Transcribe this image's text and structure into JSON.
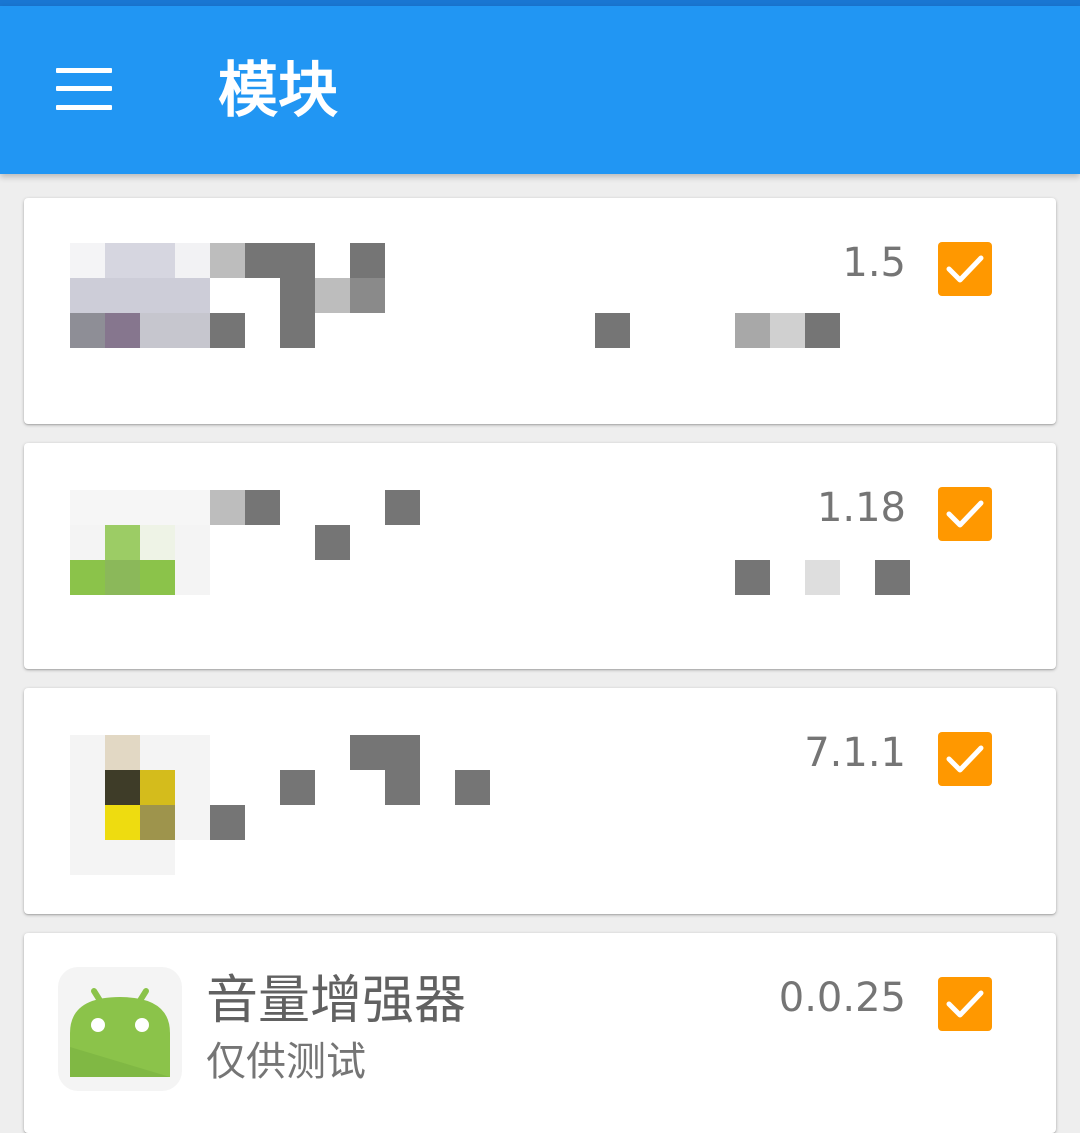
{
  "appbar": {
    "title": "模块",
    "menu_icon": "menu-icon"
  },
  "colors": {
    "appbar": "#2196F3",
    "status": "#1976D2",
    "accent": "#FF9800",
    "background": "#EEEEEE"
  },
  "modules": [
    {
      "name": "",
      "description": "",
      "version": "1.5",
      "enabled": true
    },
    {
      "name": "",
      "description": "",
      "version": "1.18",
      "enabled": true
    },
    {
      "name": "",
      "description": "",
      "version": "7.1.1",
      "enabled": true
    },
    {
      "name": "音量增强器",
      "description": "仅供测试",
      "version": "0.0.25",
      "enabled": true,
      "icon": "android-icon"
    }
  ]
}
